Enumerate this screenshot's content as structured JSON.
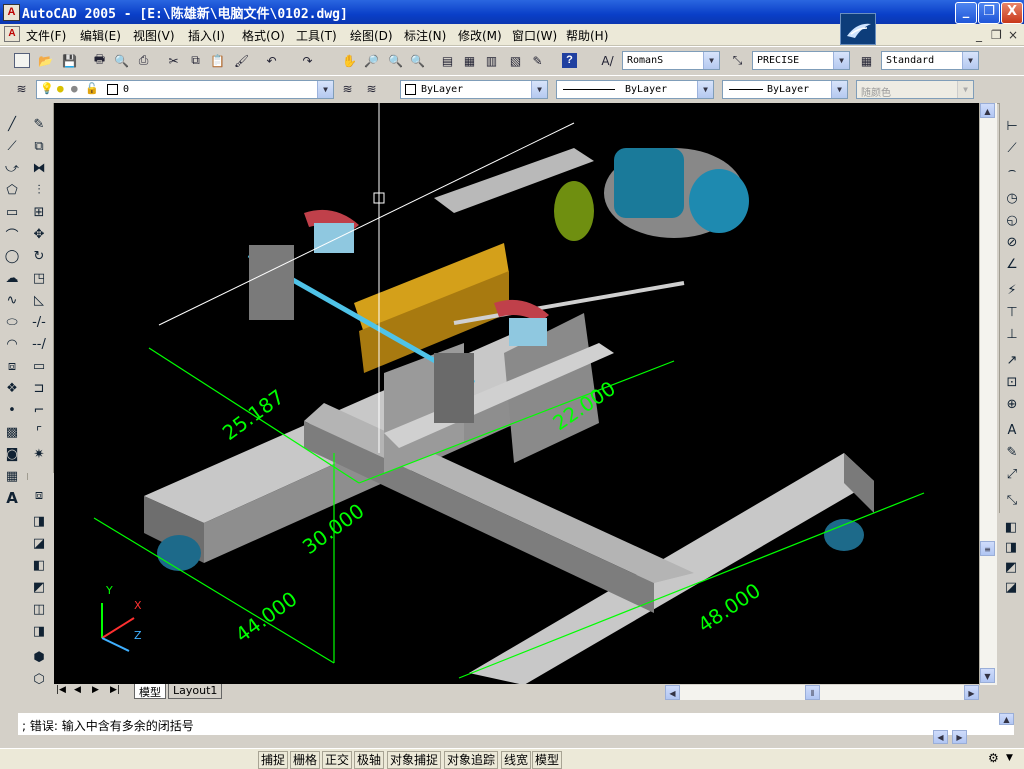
{
  "window": {
    "title": "AutoCAD 2005 - [E:\\陈雄新\\电脑文件\\0102.dwg]",
    "min_label": "_",
    "restore_label": "❐",
    "close_label": "X"
  },
  "menu": {
    "items": [
      "文件(F)",
      "编辑(E)",
      "视图(V)",
      "插入(I)",
      "格式(O)",
      "工具(T)",
      "绘图(D)",
      "标注(N)",
      "修改(M)",
      "窗口(W)",
      "帮助(H)"
    ]
  },
  "toolbar_styles": {
    "text_style": "RomanS",
    "dim_style": "PRECISE",
    "table_style": "Standard"
  },
  "layers": {
    "current_layer": "0",
    "color": "ByLayer",
    "linetype": "ByLayer",
    "lineweight": "ByLayer",
    "plot_style": "随颜色"
  },
  "drawing": {
    "dimensions": [
      "25.187",
      "22.000",
      "30.000",
      "44.000",
      "48.000"
    ],
    "ucs_x": "X",
    "ucs_y": "Y",
    "ucs_z": "Z"
  },
  "layout_tabs": [
    "模型",
    "Layout1"
  ],
  "command": {
    "line1": "; 错误: 输入中含有多余的闭括号",
    "line2": ""
  },
  "status": {
    "buttons": [
      "捕捉",
      "栅格",
      "正交",
      "极轴",
      "对象捕捉",
      "对象追踪",
      "线宽",
      "模型"
    ]
  },
  "colors": {
    "titlebar": "#0a3fc8",
    "canvas_bg": "#000000",
    "dimension": "#00ff00",
    "model_gray": "#a8a8a8",
    "motor_teal": "#1a7a9a",
    "bracket_gold": "#d4a01a"
  }
}
